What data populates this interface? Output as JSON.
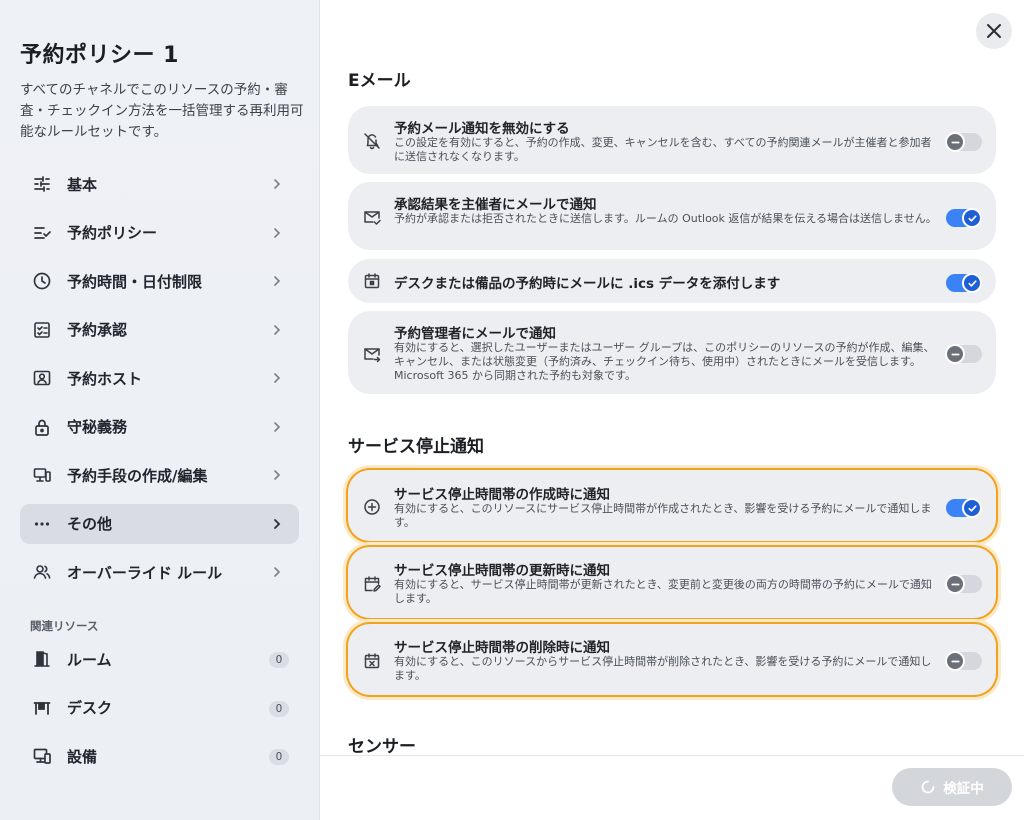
{
  "sidebar": {
    "title": "予約ポリシー 1",
    "description": "すべてのチャネルでこのリソースの予約・審査・チェックイン方法を一括管理する再利用可能なルールセットです。",
    "items": [
      {
        "label": "基本",
        "icon": "sliders-icon"
      },
      {
        "label": "予約ポリシー",
        "icon": "list-check-icon"
      },
      {
        "label": "予約時間・日付制限",
        "icon": "clock-icon"
      },
      {
        "label": "予約承認",
        "icon": "approval-checklist-icon"
      },
      {
        "label": "予約ホスト",
        "icon": "host-badge-icon"
      },
      {
        "label": "守秘義務",
        "icon": "lock-icon"
      },
      {
        "label": "予約手段の作成/編集",
        "icon": "devices-icon"
      },
      {
        "label": "その他",
        "icon": "more-horizontal-icon",
        "active": true
      },
      {
        "label": "オーバーライド ルール",
        "icon": "users-icon"
      }
    ],
    "related_heading": "関連リソース",
    "related": [
      {
        "label": "ルーム",
        "count": "0",
        "icon": "door-icon"
      },
      {
        "label": "デスク",
        "count": "0",
        "icon": "desk-icon"
      },
      {
        "label": "設備",
        "count": "0",
        "icon": "equipment-icon"
      }
    ]
  },
  "main": {
    "email_section": "Eメール",
    "email_cards": [
      {
        "title": "予約メール通知を無効にする",
        "desc": "この設定を有効にすると、予約の作成、変更、キャンセルを含む、すべての予約関連メールが主催者と参加者に送信されなくなります。",
        "enabled": false,
        "icon": "bell-off-icon"
      },
      {
        "title": "承認結果を主催者にメールで通知",
        "desc": "予約が承認または拒否されたときに送信します。ルームの Outlook 返信が結果を伝える場合は送信しません。",
        "enabled": true,
        "icon": "mail-check-icon"
      },
      {
        "title": "デスクまたは備品の予約時にメールに .ics データを添付します",
        "desc": "",
        "enabled": true,
        "icon": "calendar-icon"
      },
      {
        "title": "予約管理者にメールで通知",
        "desc": "有効にすると、選択したユーザーまたはユーザー グループは、このポリシーのリソースの予約が作成、編集、キャンセル、または状態変更（予約済み、チェックイン待ち、使用中）されたときにメールを受信します。Microsoft 365 から同期された予約も対象です。",
        "enabled": false,
        "icon": "mail-forward-icon"
      }
    ],
    "outage_section": "サービス停止通知",
    "outage_cards": [
      {
        "title": "サービス停止時間帯の作成時に通知",
        "desc": "有効にすると、このリソースにサービス停止時間帯が作成されたとき、影響を受ける予約にメールで通知します。",
        "enabled": true,
        "icon": "plus-circle-icon"
      },
      {
        "title": "サービス停止時間帯の更新時に通知",
        "desc": "有効にすると、サービス停止時間帯が更新されたとき、変更前と変更後の両方の時間帯の予約にメールで通知します。",
        "enabled": false,
        "icon": "calendar-edit-icon"
      },
      {
        "title": "サービス停止時間帯の削除時に通知",
        "desc": "有効にすると、このリソースからサービス停止時間帯が削除されたとき、影響を受ける予約にメールで通知します。",
        "enabled": false,
        "icon": "calendar-x-icon"
      }
    ],
    "sensor_section": "センサー"
  },
  "footer": {
    "verify_label": "検証中"
  },
  "colors": {
    "toggle_on": "#3b82f6",
    "highlight": "#f2a31b"
  }
}
